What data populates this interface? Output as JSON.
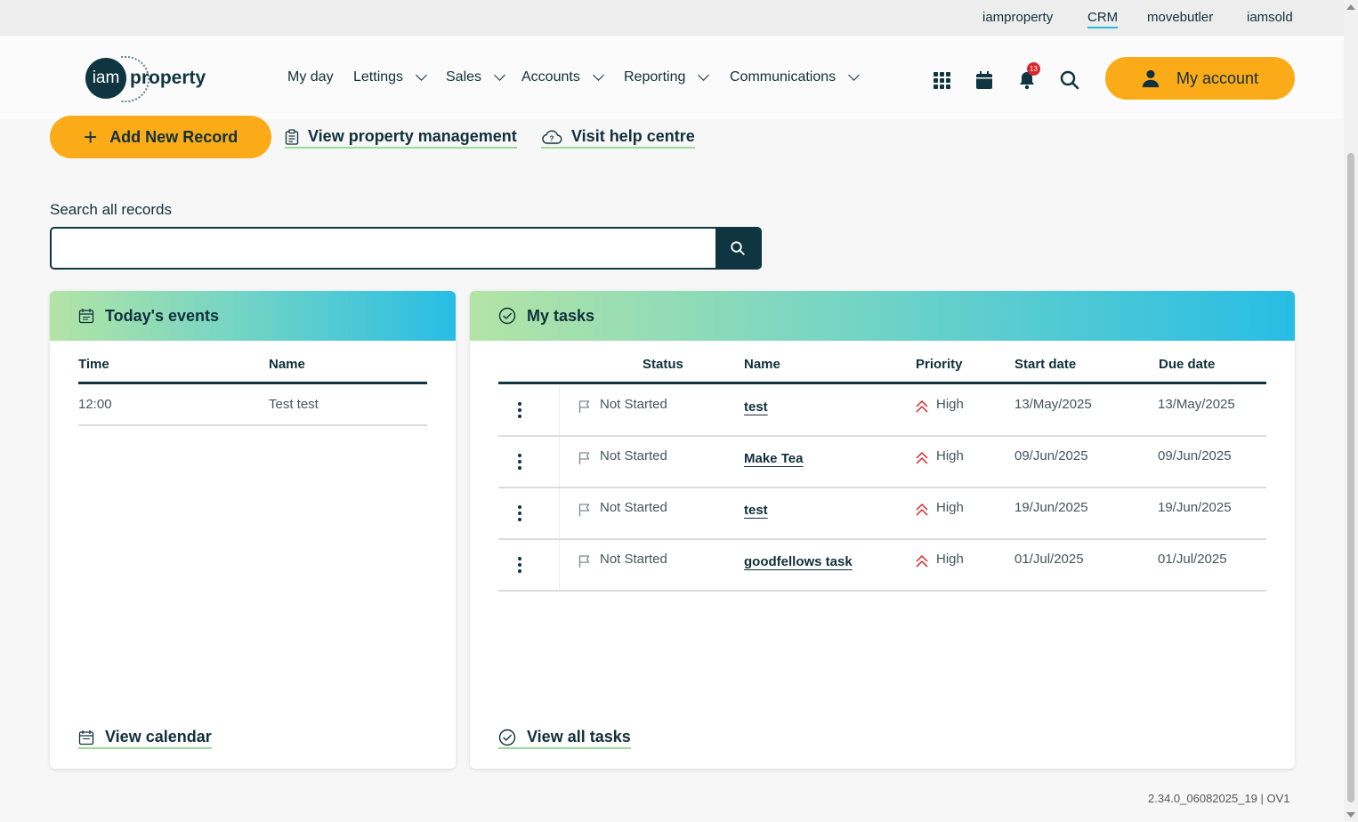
{
  "brand_bar": {
    "links": [
      {
        "label": "iamproperty",
        "active": false
      },
      {
        "label": "CRM",
        "active": true
      },
      {
        "label": "movebutler",
        "active": false
      },
      {
        "label": "iamsold",
        "active": false
      }
    ]
  },
  "header": {
    "logo": {
      "circle_text": "iam",
      "text": "property"
    },
    "nav": [
      {
        "label": "My day",
        "dropdown": false
      },
      {
        "label": "Lettings",
        "dropdown": true
      },
      {
        "label": "Sales",
        "dropdown": true
      },
      {
        "label": "Accounts",
        "dropdown": true
      },
      {
        "label": "Reporting",
        "dropdown": true
      },
      {
        "label": "Communications",
        "dropdown": true
      }
    ],
    "icons": [
      "apps-grid-icon",
      "calendar-icon",
      "bell-icon",
      "search-icon"
    ],
    "notification_count": "13",
    "account_label": "My account"
  },
  "actions": {
    "add_record": "Add New Record",
    "view_property_management": "View property management",
    "visit_help_centre": "Visit help centre"
  },
  "search": {
    "label": "Search all records",
    "placeholder": "",
    "value": ""
  },
  "events": {
    "title": "Today's events",
    "columns": [
      "Time",
      "Name"
    ],
    "rows": [
      {
        "time": "12:00",
        "name": "Test test"
      }
    ],
    "footer_link": "View calendar"
  },
  "tasks": {
    "title": "My tasks",
    "columns": [
      "Status",
      "Name",
      "Priority",
      "Start date",
      "Due date"
    ],
    "rows": [
      {
        "status": "Not Started",
        "name": "test",
        "priority": "High",
        "start": "13/May/2025",
        "due": "13/May/2025"
      },
      {
        "status": "Not Started",
        "name": "Make Tea",
        "priority": "High",
        "start": "09/Jun/2025",
        "due": "09/Jun/2025"
      },
      {
        "status": "Not Started",
        "name": "test",
        "priority": "High",
        "start": "19/Jun/2025",
        "due": "19/Jun/2025"
      },
      {
        "status": "Not Started",
        "name": "goodfellows task",
        "priority": "High",
        "start": "01/Jul/2025",
        "due": "01/Jul/2025"
      }
    ],
    "footer_link": "View all tasks"
  },
  "version": "2.34.0_06082025_19 | OV1",
  "colors": {
    "accent_orange": "#fbab18",
    "dark_teal": "#0f3640",
    "link_underline": "#9bdc9a",
    "priority_high": "#d8262e"
  }
}
